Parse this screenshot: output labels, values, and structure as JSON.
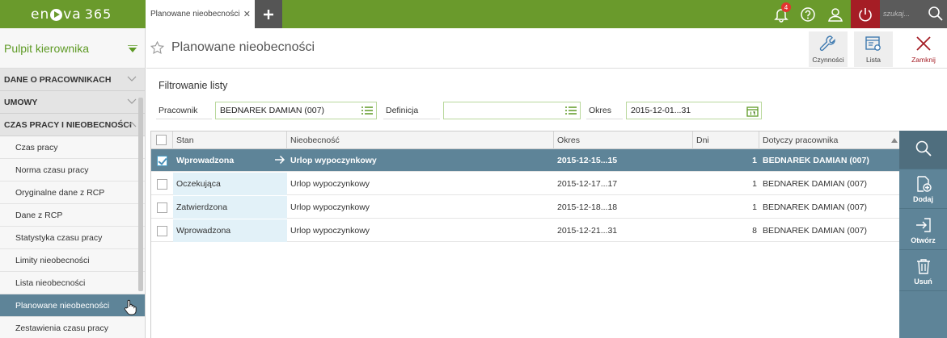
{
  "app": {
    "logo_text_1": "en",
    "logo_text_2": "va",
    "logo_version": "365"
  },
  "tabs": [
    {
      "label": "Planowane nieobecności"
    }
  ],
  "topbar": {
    "notifications_count": "4",
    "search_placeholder": "szukaj..."
  },
  "sidebar": {
    "title": "Pulpit kierownika",
    "sections": [
      {
        "label": "DANE O PRACOWNIKACH"
      },
      {
        "label": "UMOWY"
      },
      {
        "label": "CZAS PRACY I NIEOBECNOŚCI"
      }
    ],
    "items": [
      {
        "label": "Czas pracy"
      },
      {
        "label": "Norma czasu pracy"
      },
      {
        "label": "Oryginalne dane z RCP"
      },
      {
        "label": "Dane z RCP"
      },
      {
        "label": "Statystyka czasu pracy"
      },
      {
        "label": "Limity nieobecności"
      },
      {
        "label": "Lista nieobecności"
      },
      {
        "label": "Planowane nieobecności"
      },
      {
        "label": "Zestawienia czasu pracy"
      }
    ]
  },
  "page": {
    "title": "Planowane nieobecności"
  },
  "toolbar": {
    "czynnosci": "Czynności",
    "lista": "Lista",
    "zamknij": "Zamknij"
  },
  "filter": {
    "title": "Filtrowanie listy",
    "pracownik_label": "Pracownik",
    "pracownik_value": "BEDNAREK DAMIAN (007)",
    "definicja_label": "Definicja",
    "definicja_value": "",
    "okres_label": "Okres",
    "okres_value": "2015-12-01...31"
  },
  "grid": {
    "columns": [
      "Stan",
      "Nieobecność",
      "Okres",
      "Dni",
      "Dotyczy pracownika"
    ],
    "rows": [
      {
        "stan": "Wprowadzona",
        "nieobecnosc": "Urlop wypoczynkowy",
        "okres": "2015-12-15...15",
        "dni": "1",
        "pracownik": "BEDNAREK DAMIAN (007)"
      },
      {
        "stan": "Oczekująca",
        "nieobecnosc": "Urlop wypoczynkowy",
        "okres": "2015-12-17...17",
        "dni": "1",
        "pracownik": "BEDNAREK DAMIAN (007)"
      },
      {
        "stan": "Zatwierdzona",
        "nieobecnosc": "Urlop wypoczynkowy",
        "okres": "2015-12-18...18",
        "dni": "1",
        "pracownik": "BEDNAREK DAMIAN (007)"
      },
      {
        "stan": "Wprowadzona",
        "nieobecnosc": "Urlop wypoczynkowy",
        "okres": "2015-12-21...31",
        "dni": "8",
        "pracownik": "BEDNAREK DAMIAN (007)"
      }
    ]
  },
  "actions": {
    "dodaj": "Dodaj",
    "otworz": "Otwórz",
    "usun": "Usuń"
  }
}
